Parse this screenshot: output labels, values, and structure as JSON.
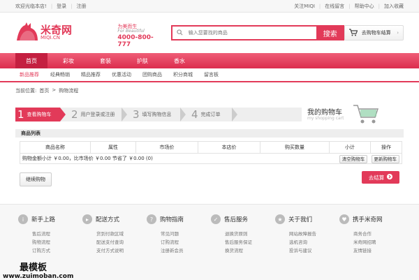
{
  "topbar": {
    "welcome": "欢迎光临本店!",
    "login": "登录",
    "register": "注册",
    "follow": "关注MIQI",
    "message": "在线留言",
    "help": "帮助中心",
    "favorite": "加入收藏"
  },
  "header": {
    "logo_cn": "米奇网",
    "logo_domain": "MIQI.CN",
    "slogan_cn": "为美而生",
    "slogan_en": "For Beautiful",
    "hotline": "4000-800-777",
    "search_placeholder": "输入您要找的商品",
    "search_button": "搜索",
    "cart_button": "去购物车结算"
  },
  "nav": {
    "items": [
      "首页",
      "彩妆",
      "套装",
      "护肤",
      "香水"
    ]
  },
  "subnav": {
    "items": [
      "新品推荐",
      "经典畅销",
      "精品推荐",
      "优惠活动",
      "团购商品",
      "积分商城",
      "留言板"
    ]
  },
  "breadcrumb": {
    "prefix": "当前位置:",
    "home": "首页",
    "sep": ">",
    "current": "购物流程"
  },
  "steps": [
    {
      "num": "1",
      "label": "查看购物车"
    },
    {
      "num": "2",
      "label": "用户登录或注册"
    },
    {
      "num": "3",
      "label": "填写购物信息"
    },
    {
      "num": "4",
      "label": "完成订单"
    }
  ],
  "mycart": {
    "title": "我的购物车",
    "subtitle": "my shopping cart"
  },
  "product_list": {
    "title": "商品列表",
    "columns": [
      "商品名称",
      "属性",
      "市场价",
      "本店价",
      "购买数量",
      "小计",
      "操作"
    ],
    "summary": "购物金额小计 ￥0.00，比市场价 ￥0.00 节省了 ￥0.00 (0)",
    "clear_button": "清空购物车",
    "update_button": "更新购物车"
  },
  "actions": {
    "continue": "继续购物",
    "checkout": "去结算"
  },
  "footer": {
    "columns": [
      {
        "title": "新手上路",
        "links": [
          "售后流程",
          "购物流程",
          "订购方式"
        ]
      },
      {
        "title": "配送方式",
        "links": [
          "货到付款区域",
          "配送支付查询",
          "支付方式说明"
        ]
      },
      {
        "title": "购物指南",
        "links": [
          "常见问题",
          "订购流程",
          "注册新会员"
        ]
      },
      {
        "title": "售后服务",
        "links": [
          "退换货原则",
          "售后服务保证",
          "换货流程"
        ]
      },
      {
        "title": "关于我们",
        "links": [
          "网站故障报告",
          "选机咨询",
          "投诉与建议"
        ]
      },
      {
        "title": "携手米奇网",
        "links": [
          "商务合作",
          "米奇网招聘",
          "友情链接"
        ]
      }
    ]
  },
  "watermark": {
    "cn": "最模板",
    "en": "www.zuimoban.com"
  },
  "colors": {
    "brand": "#e23a59"
  }
}
